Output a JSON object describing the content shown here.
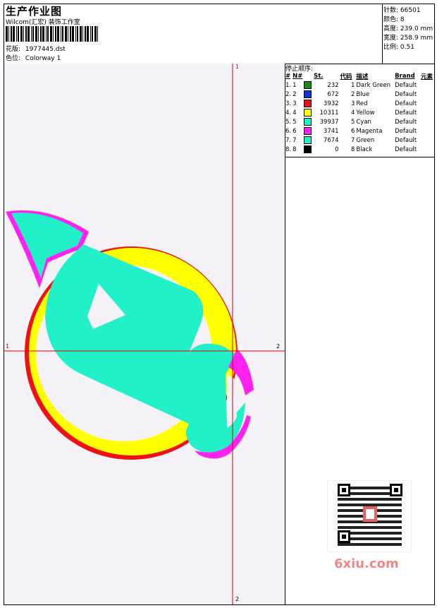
{
  "header": {
    "title": "生产作业图",
    "company": "Wilcom(汇宏) 装饰工作室",
    "design_label": "花版:",
    "design_value": "1977445.dst",
    "colorway_label": "色位:",
    "colorway_value": "Colorway 1"
  },
  "specs": [
    {
      "label": "针数:",
      "value": "66501"
    },
    {
      "label": "颜色:",
      "value": "8"
    },
    {
      "label": "高度:",
      "value": "239.0 mm"
    },
    {
      "label": "宽度:",
      "value": "258.9 mm"
    },
    {
      "label": "比例:",
      "value": "0.51"
    }
  ],
  "stop_sequence": {
    "label": "停止顺序:",
    "columns": [
      "#",
      "N#",
      "St.",
      "代码",
      "描述",
      "Brand",
      "元素"
    ],
    "rows": [
      {
        "idx": "1.",
        "n": "1",
        "color": "#1a8a1a",
        "st": "232",
        "code": "1",
        "desc": "Dark Green",
        "brand": "Default"
      },
      {
        "idx": "2.",
        "n": "2",
        "color": "#1030e0",
        "st": "672",
        "code": "2",
        "desc": "Blue",
        "brand": "Default"
      },
      {
        "idx": "3.",
        "n": "3",
        "color": "#ee1111",
        "st": "3932",
        "code": "3",
        "desc": "Red",
        "brand": "Default"
      },
      {
        "idx": "4.",
        "n": "4",
        "color": "#ffff00",
        "st": "10311",
        "code": "4",
        "desc": "Yellow",
        "brand": "Default"
      },
      {
        "idx": "5.",
        "n": "5",
        "color": "#22f0c8",
        "st": "39937",
        "code": "5",
        "desc": "Cyan",
        "brand": "Default"
      },
      {
        "idx": "6.",
        "n": "6",
        "color": "#ff22ee",
        "st": "3741",
        "code": "6",
        "desc": "Magenta",
        "brand": "Default"
      },
      {
        "idx": "7.",
        "n": "7",
        "color": "#22f0c8",
        "st": "7674",
        "code": "7",
        "desc": "Green",
        "brand": "Default"
      },
      {
        "idx": "8.",
        "n": "8",
        "color": "#000000",
        "st": "0",
        "code": "8",
        "desc": "Black",
        "brand": "Default"
      }
    ]
  },
  "axis_labels": {
    "top": "1",
    "left": "1",
    "right": "2",
    "bottom": "2"
  },
  "watermark": "6xiu.com",
  "colors": {
    "red": "#ee1111",
    "yellow": "#ffff00",
    "cyan": "#22f0c8",
    "magenta": "#ff22ee",
    "crosshair": "#dd0000"
  }
}
